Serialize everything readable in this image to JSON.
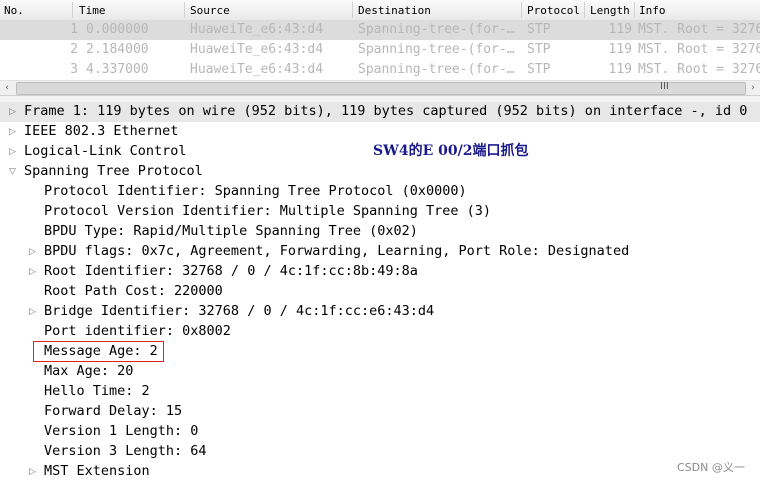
{
  "packet_list": {
    "columns": [
      "No.",
      "Time",
      "Source",
      "Destination",
      "Protocol",
      "Length",
      "Info"
    ],
    "rows": [
      {
        "no": "1",
        "time": "0.000000",
        "source": "HuaweiTe_e6:43:d4",
        "destination": "Spanning-tree-(for-…",
        "protocol": "STP",
        "length": "119",
        "info": "MST. Root = 3276"
      },
      {
        "no": "2",
        "time": "2.184000",
        "source": "HuaweiTe_e6:43:d4",
        "destination": "Spanning-tree-(for-…",
        "protocol": "STP",
        "length": "119",
        "info": "MST. Root = 3276"
      },
      {
        "no": "3",
        "time": "4.337000",
        "source": "HuaweiTe_e6:43:d4",
        "destination": "Spanning-tree-(for-…",
        "protocol": "STP",
        "length": "119",
        "info": "MST. Root = 3276"
      }
    ]
  },
  "scrollbar": {
    "left_arrow": "‹",
    "right_arrow": "›",
    "grip": "III"
  },
  "details": {
    "frame": "Frame 1: 119 bytes on wire (952 bits), 119 bytes captured (952 bits) on interface -, id 0",
    "ethernet": "IEEE 802.3 Ethernet",
    "llc": "Logical-Link Control",
    "stp": "Spanning Tree Protocol",
    "fields": [
      {
        "text": "Protocol Identifier: Spanning Tree Protocol (0x0000)",
        "expandable": false
      },
      {
        "text": "Protocol Version Identifier: Multiple Spanning Tree (3)",
        "expandable": false
      },
      {
        "text": "BPDU Type: Rapid/Multiple Spanning Tree (0x02)",
        "expandable": false
      },
      {
        "text": "BPDU flags: 0x7c, Agreement, Forwarding, Learning, Port Role: Designated",
        "expandable": true
      },
      {
        "text": "Root Identifier: 32768 / 0 / 4c:1f:cc:8b:49:8a",
        "expandable": true
      },
      {
        "text": "Root Path Cost: 220000",
        "expandable": false
      },
      {
        "text": "Bridge Identifier: 32768 / 0 / 4c:1f:cc:e6:43:d4",
        "expandable": true
      },
      {
        "text": "Port identifier: 0x8002",
        "expandable": false
      },
      {
        "text": "Message Age: 2",
        "expandable": false
      },
      {
        "text": "Max Age: 20",
        "expandable": false
      },
      {
        "text": "Hello Time: 2",
        "expandable": false
      },
      {
        "text": "Forward Delay: 15",
        "expandable": false
      },
      {
        "text": "Version 1 Length: 0",
        "expandable": false
      },
      {
        "text": "Version 3 Length: 64",
        "expandable": false
      },
      {
        "text": "MST Extension",
        "expandable": true
      }
    ]
  },
  "icons": {
    "collapsed": "▷",
    "expanded": "▽"
  },
  "annotation": "SW4的E 00/2端口抓包",
  "watermark": "CSDN @义一",
  "colors": {
    "highlight_box": "#dd2222",
    "selected_row": "#dcdcdc",
    "annotation": "#1a1a8a"
  }
}
